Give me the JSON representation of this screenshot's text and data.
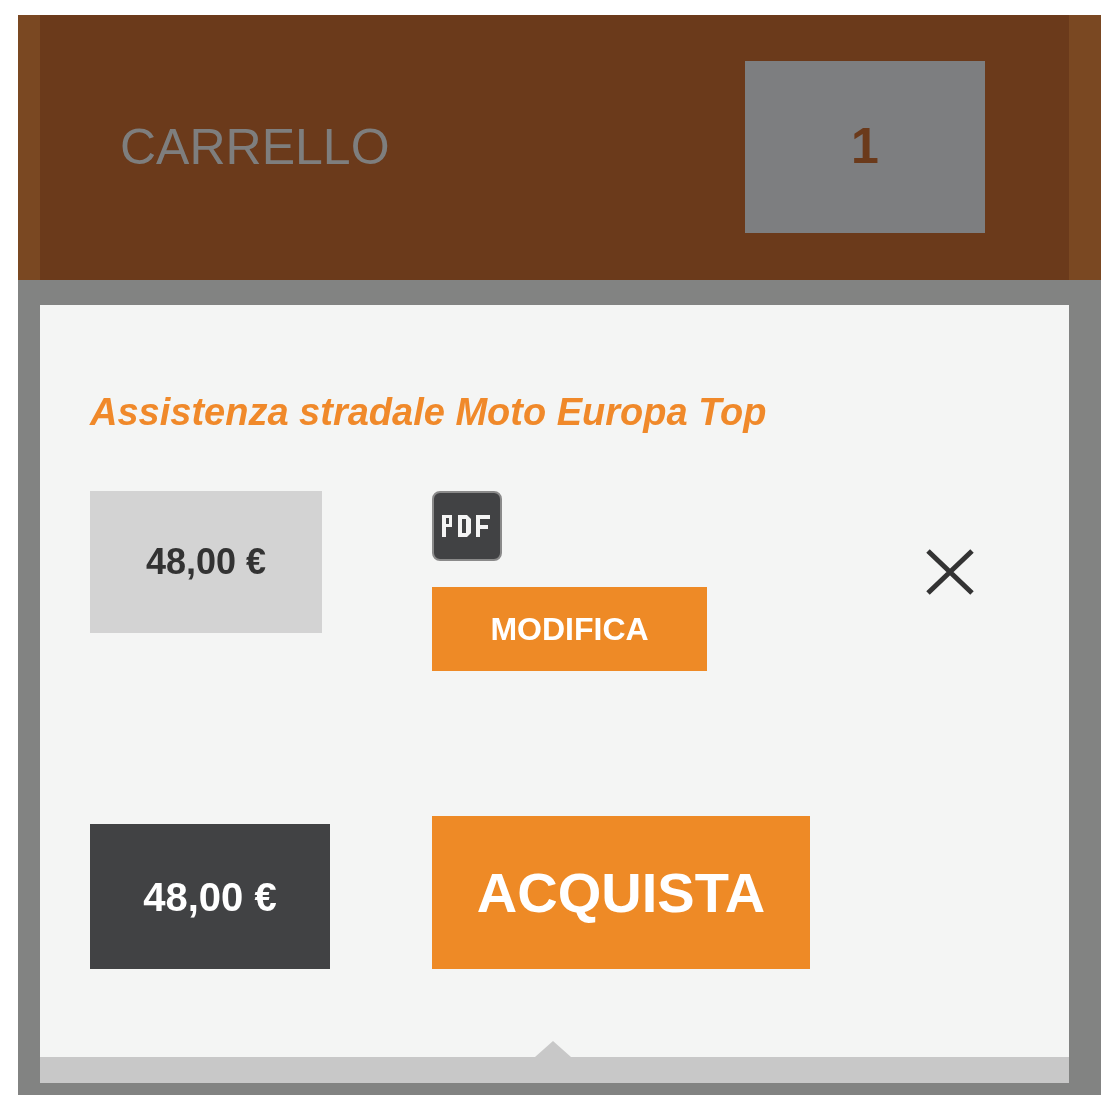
{
  "header": {
    "title": "CARRELLO",
    "count": "1"
  },
  "cart": {
    "items": [
      {
        "name": "Assistenza stradale Moto Europa Top",
        "price": "48,00 €",
        "edit_label": "MODIFICA"
      }
    ],
    "total": "48,00 €",
    "buy_label": "ACQUISTA"
  }
}
